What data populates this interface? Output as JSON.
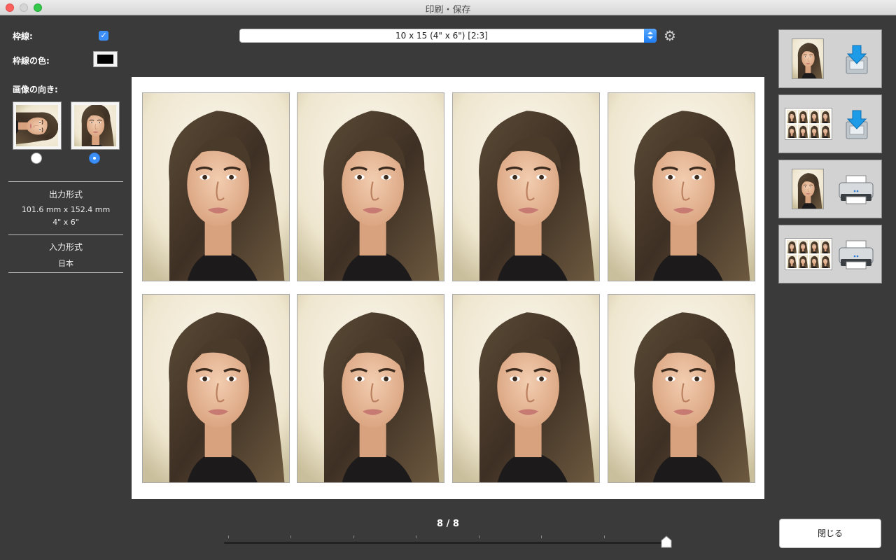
{
  "window": {
    "title": "印刷・保存"
  },
  "left_panel": {
    "border_label": "枠線:",
    "border_checked": true,
    "border_color_label": "枠線の色:",
    "border_color": "#000000",
    "orientation_label": "画像の向き:",
    "orientation_selected": "portrait",
    "output_format": {
      "heading": "出力形式",
      "mm": "101.6 mm x 152.4 mm",
      "inches": "4\" x 6\""
    },
    "input_format": {
      "heading": "入力形式",
      "value": "日本"
    }
  },
  "toolbar": {
    "paper_size": "10 x 15 (4\" x 6\") [2:3]"
  },
  "sheet": {
    "photo_count": 8
  },
  "pager": {
    "text": "8 / 8",
    "position": 1.0
  },
  "actions": {
    "close_label": "閉じる"
  },
  "colors": {
    "accent": "#3b8ff7",
    "panel_bg": "#3a3a3a",
    "button_bg": "#d2d2d2"
  }
}
